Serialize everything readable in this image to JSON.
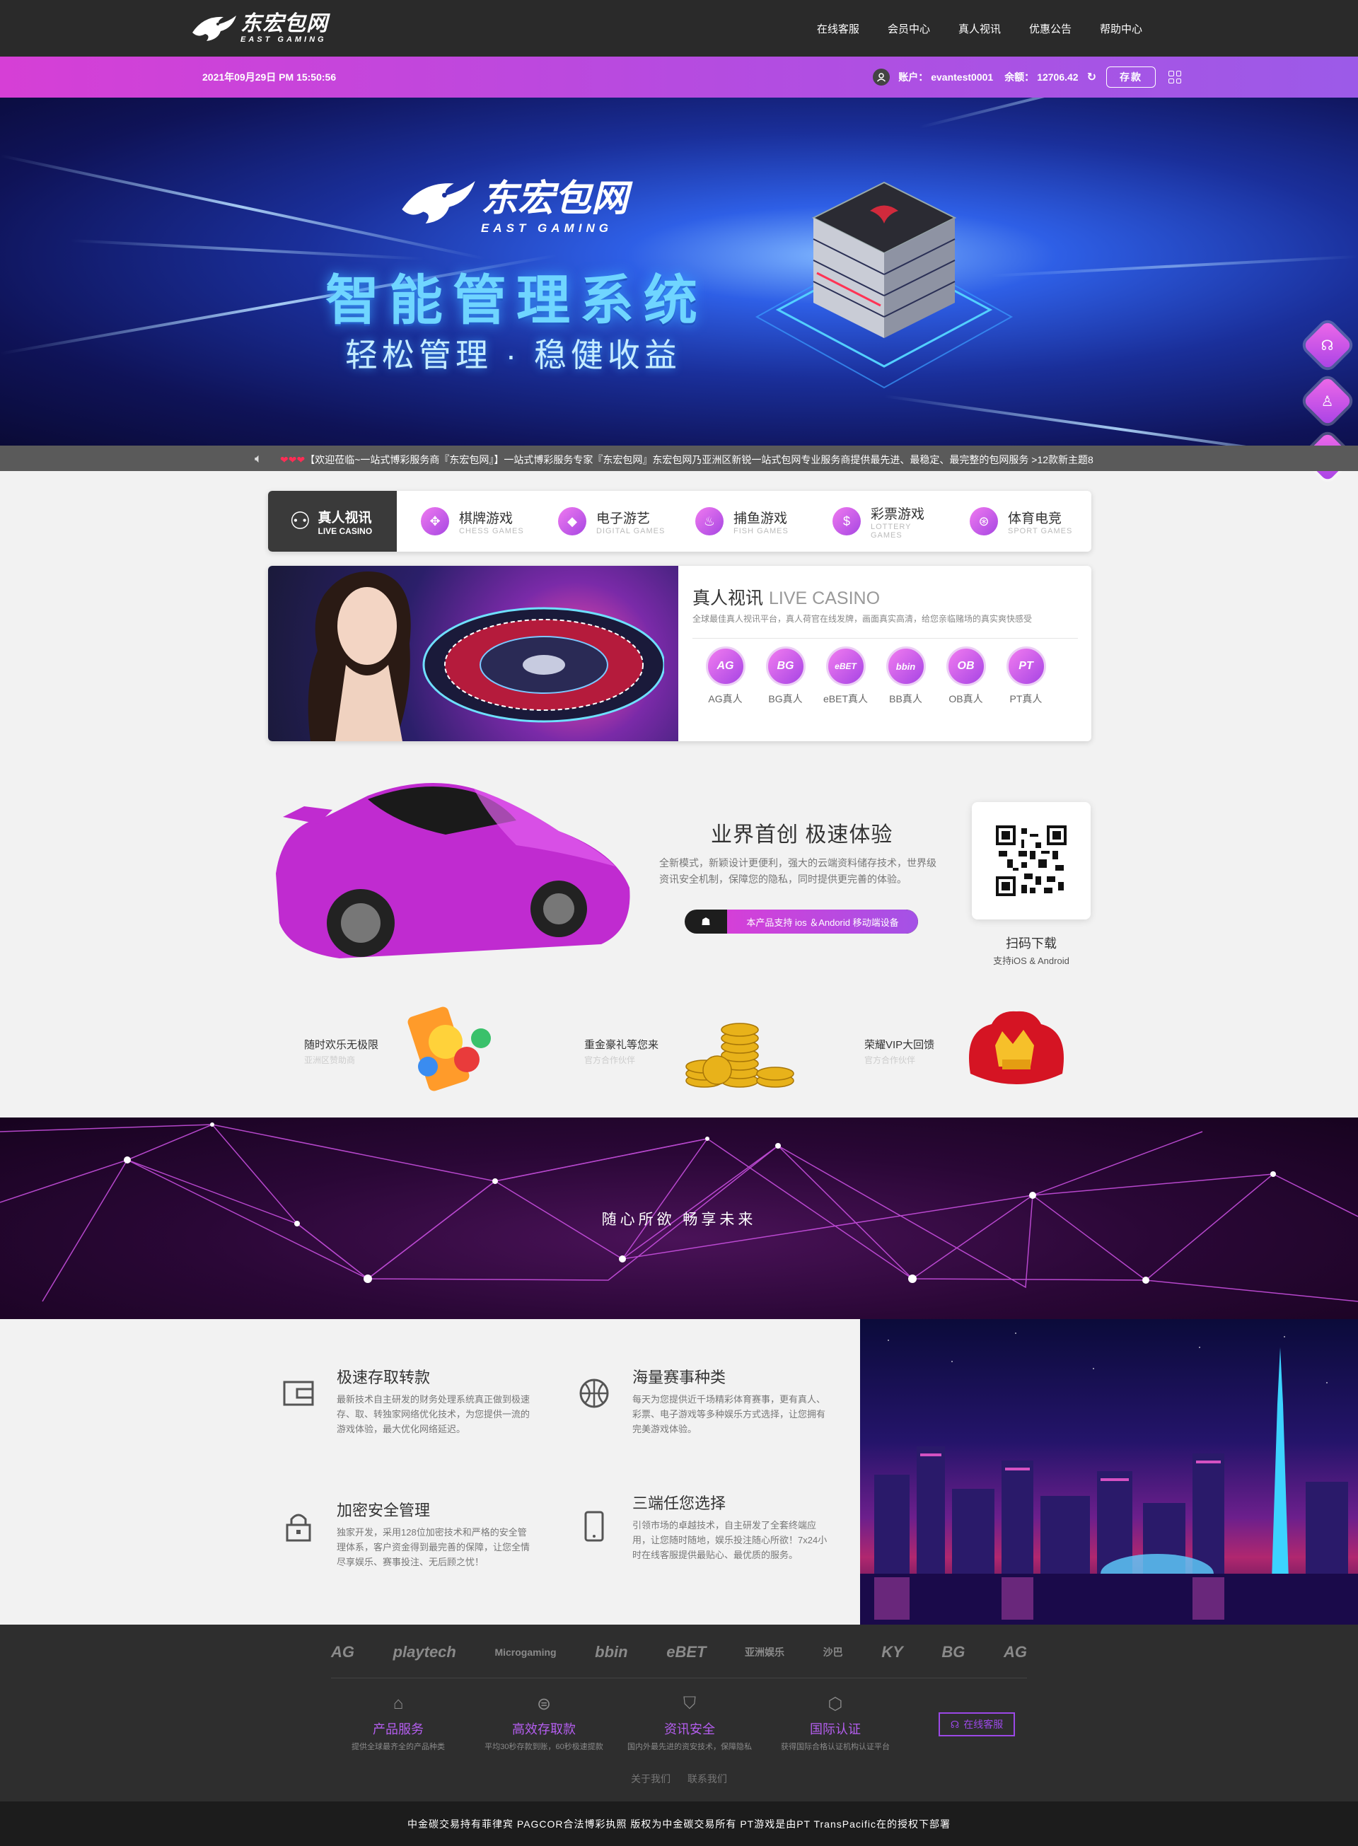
{
  "header": {
    "logo_cn": "东宏包网",
    "logo_en": "EAST GAMING",
    "nav": [
      "在线客服",
      "会员中心",
      "真人视讯",
      "优惠公告",
      "帮助中心"
    ]
  },
  "status_bar": {
    "datetime": "2021年09月29日 PM 15:50:56",
    "account_label": "账户：",
    "account_value": "evantest0001",
    "balance_label": "余额：",
    "balance_value": "12706.42",
    "deposit": "存款"
  },
  "banner": {
    "logo_cn": "东宏包网",
    "logo_en": "EAST GAMING",
    "title": "智能管理系统",
    "subtitle": "轻松管理 · 稳健收益"
  },
  "ticker": {
    "hearts": "❤❤❤",
    "text": "【欢迎莅临~一站式博彩服务商『东宏包网』】一站式博彩服务专家『东宏包网』东宏包网乃亚洲区新锐一站式包网专业服务商提供最先进、最稳定、最完整的包网服务 >12款新主题8"
  },
  "game_tabs": [
    {
      "cn": "真人视讯",
      "en": "LIVE CASINO"
    },
    {
      "cn": "棋牌游戏",
      "en": "CHESS GAMES"
    },
    {
      "cn": "电子游艺",
      "en": "DIGITAL GAMES"
    },
    {
      "cn": "捕鱼游戏",
      "en": "FISH GAMES"
    },
    {
      "cn": "彩票游戏",
      "en": "LOTTERY GAMES"
    },
    {
      "cn": "体育电竞",
      "en": "SPORT GAMES"
    }
  ],
  "live": {
    "title_cn": "真人视讯",
    "title_en": "LIVE CASINO",
    "desc": "全球最佳真人视讯平台，真人荷官在线发牌，画面真实高清，给您亲临赌场的真实爽快感受",
    "providers": [
      {
        "logo": "AG",
        "label": "AG真人"
      },
      {
        "logo": "BG",
        "label": "BG真人"
      },
      {
        "logo": "eBET",
        "label": "eBET真人"
      },
      {
        "logo": "bbin",
        "label": "BB真人"
      },
      {
        "logo": "OB",
        "label": "OB真人"
      },
      {
        "logo": "PT",
        "label": "PT真人"
      }
    ]
  },
  "app": {
    "title": "业界首创 极速体验",
    "desc": "全新模式，新颖设计更便利，强大的云端资料储存技术，世界级资讯安全机制，保障您的隐私，同时提供更完善的体验。",
    "btn": "本产品支持 ios ＆Andorid 移动端设备",
    "qr_title": "扫码下载",
    "qr_sub": "支持iOS & Android"
  },
  "features": [
    {
      "title": "随时欢乐无极限",
      "sub": "亚洲区赞助商"
    },
    {
      "title": "重金豪礼等您来",
      "sub": "官方合作伙伴"
    },
    {
      "title": "荣耀VIP大回馈",
      "sub": "官方合作伙伴"
    }
  ],
  "network_banner": {
    "text": "随心所欲 畅享未来"
  },
  "advantages": [
    {
      "title": "极速存取转款",
      "desc": "最新技术自主研发的财务处理系统真正做到极速存、取、转独家网络优化技术，为您提供一流的游戏体验，最大优化网络延迟。"
    },
    {
      "title": "海量赛事种类",
      "desc": "每天为您提供近千场精彩体育赛事，更有真人、彩票、电子游戏等多种娱乐方式选择，让您拥有完美游戏体验。"
    },
    {
      "title": "加密安全管理",
      "desc": "独家开发，采用128位加密技术和严格的安全管理体系，客户资金得到最完善的保障，让您全情尽享娱乐、赛事投注、无后顾之忧！"
    },
    {
      "title": "三端任您选择",
      "desc": "引领市场的卓越技术，自主研发了全套终端应用，让您随时随地，娱乐投注随心所欲！7x24小时在线客服提供最贴心、最优质的服务。"
    }
  ],
  "footer": {
    "partners": [
      "AG",
      "playtech",
      "Microgaming",
      "bbin",
      "eBET",
      "亚洲娱乐",
      "沙巴",
      "KY",
      "BG",
      "AG"
    ],
    "cols": [
      {
        "title": "产品服务",
        "desc": "提供全球最齐全的产品种类"
      },
      {
        "title": "高效存取款",
        "desc": "平均30秒存款到账，60秒极速提款"
      },
      {
        "title": "资讯安全",
        "desc": "国内外最先进的资安技术，保障隐私"
      },
      {
        "title": "国际认证",
        "desc": "获得国际合格认证机构认证平台"
      }
    ],
    "cs_btn": "在线客服",
    "links": [
      "关于我们",
      "联系我们"
    ],
    "copyright": "中金碳交易持有菲律宾 PAGCOR合法博彩执照 版权为中金碳交易所有 PT游戏是由PT TransPacific在的授权下部署"
  }
}
